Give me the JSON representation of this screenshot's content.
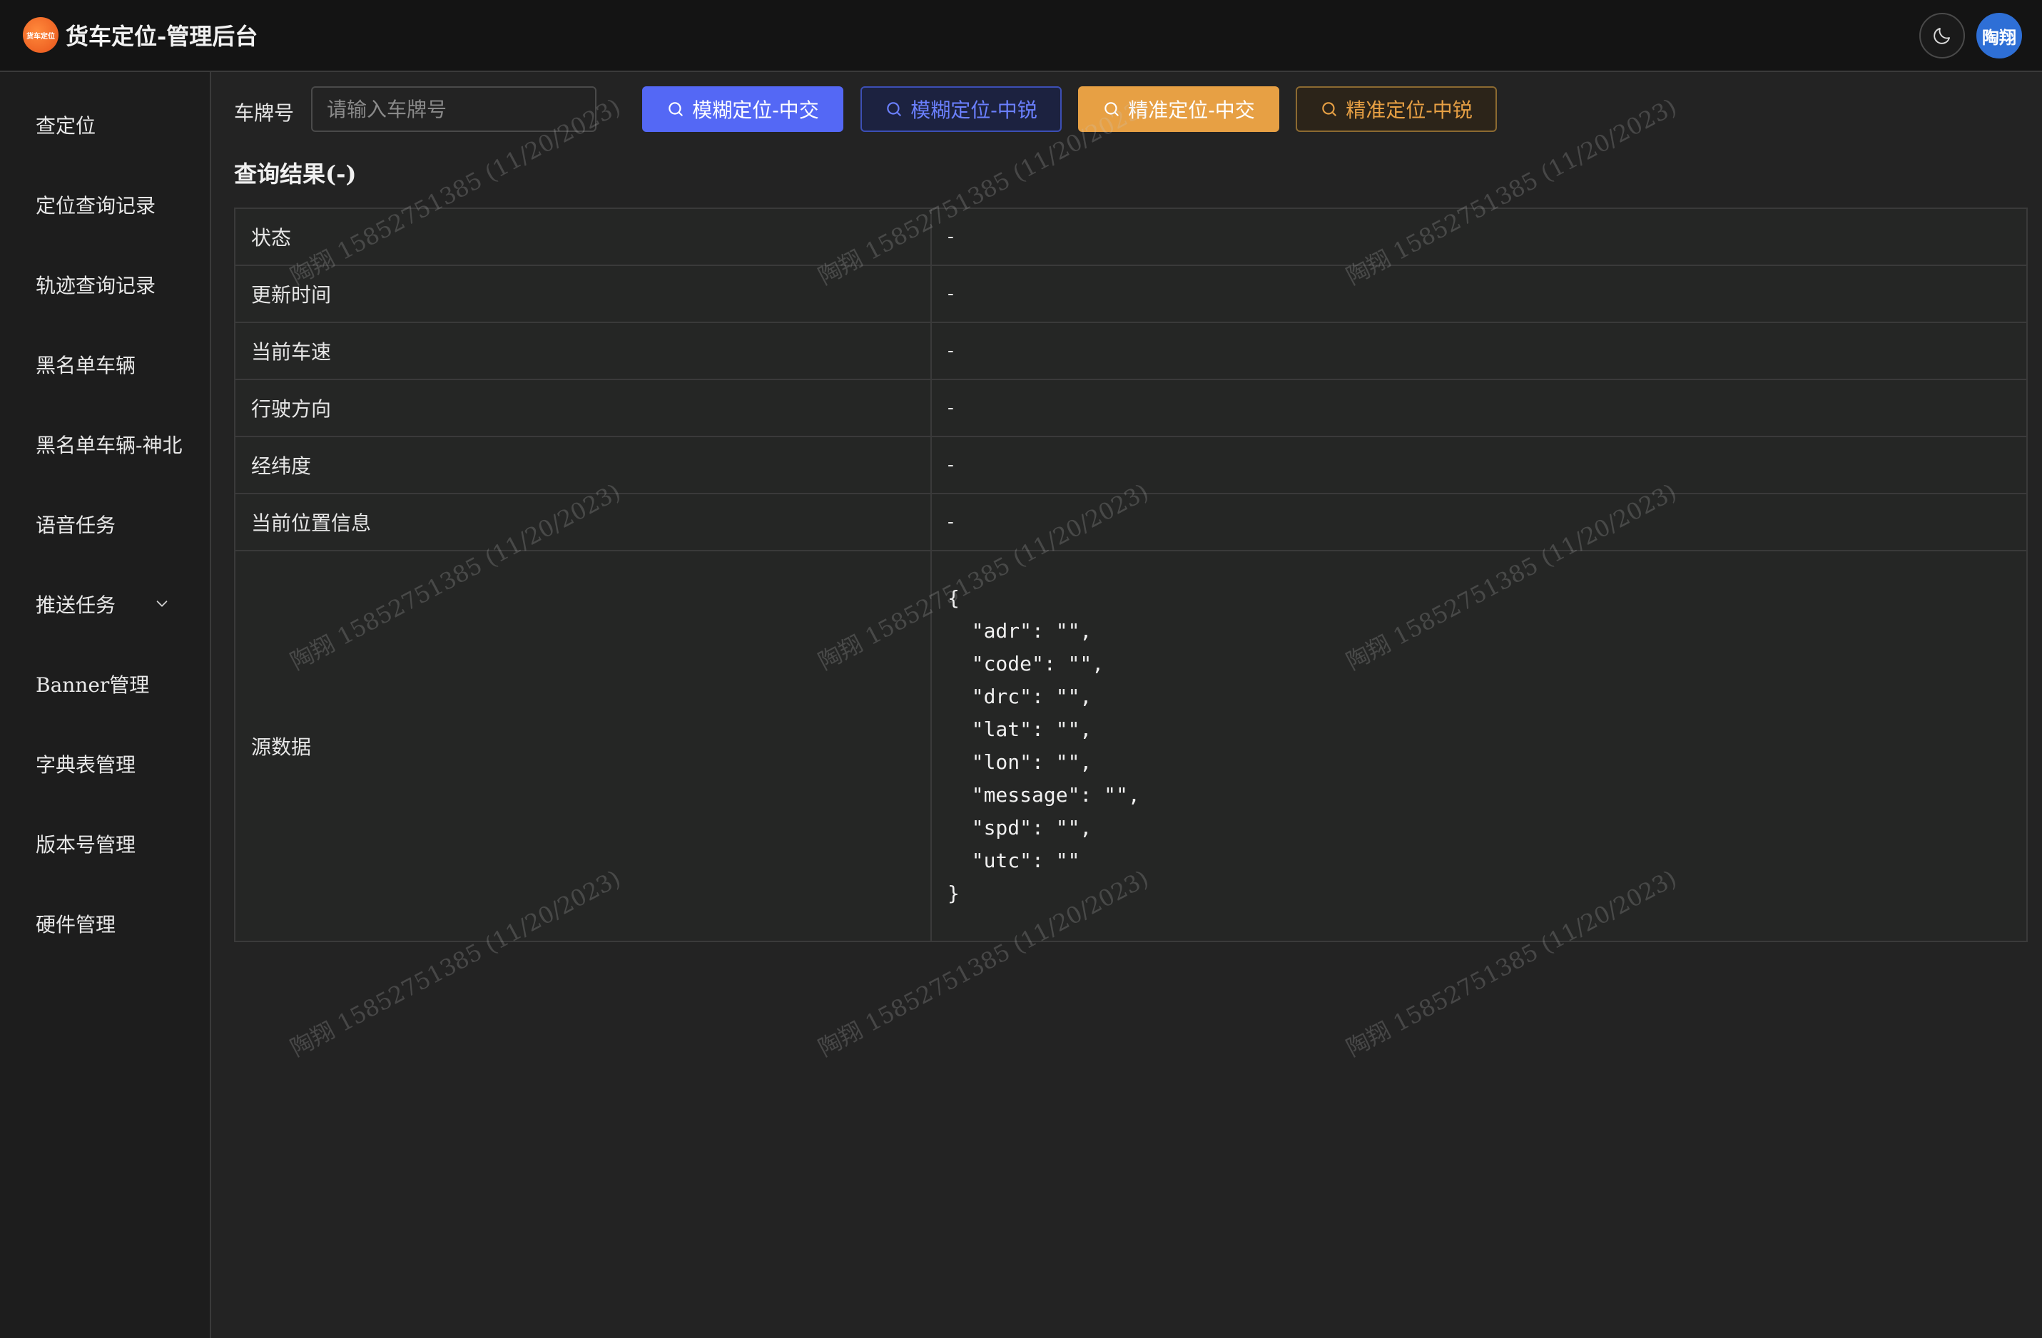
{
  "header": {
    "logo_text": "货车定位",
    "title": "货车定位-管理后台",
    "theme_icon": "moon-icon",
    "avatar_text": "陶翔"
  },
  "sidebar": {
    "items": [
      {
        "label": "查定位"
      },
      {
        "label": "定位查询记录"
      },
      {
        "label": "轨迹查询记录"
      },
      {
        "label": "黑名单车辆"
      },
      {
        "label": "黑名单车辆-神北"
      },
      {
        "label": "语音任务"
      },
      {
        "label": "推送任务",
        "icon": "chevron-down-icon"
      },
      {
        "label": "Banner管理"
      },
      {
        "label": "字典表管理"
      },
      {
        "label": "版本号管理"
      },
      {
        "label": "硬件管理"
      }
    ]
  },
  "search": {
    "label": "车牌号",
    "placeholder": "请输入车牌号",
    "value": ""
  },
  "buttons": {
    "fuzzy_zhongjiao": "模糊定位-中交",
    "fuzzy_zhongrui": "模糊定位-中锐",
    "precise_zhongjiao": "精准定位-中交",
    "precise_zhongrui": "精准定位-中锐",
    "icon": "search-icon"
  },
  "result": {
    "title": "查询结果(-)",
    "rows": [
      {
        "label": "状态",
        "value": "-"
      },
      {
        "label": "更新时间",
        "value": "-"
      },
      {
        "label": "当前车速",
        "value": "-"
      },
      {
        "label": "行驶方向",
        "value": "-"
      },
      {
        "label": "经纬度",
        "value": "-"
      },
      {
        "label": "当前位置信息",
        "value": "-"
      }
    ],
    "source_label": "源数据",
    "source_json": "{\n  \"adr\": \"\",\n  \"code\": \"\",\n  \"drc\": \"\",\n  \"lat\": \"\",\n  \"lon\": \"\",\n  \"message\": \"\",\n  \"spd\": \"\",\n  \"utc\": \"\"\n}"
  },
  "watermark": {
    "text": "陶翔 15852751385 (11/20/2023)"
  },
  "colors": {
    "primary": "#5468f5",
    "warning": "#e7a044",
    "background": "#232323",
    "header": "#141414",
    "sidebar": "#1d1d1d"
  }
}
